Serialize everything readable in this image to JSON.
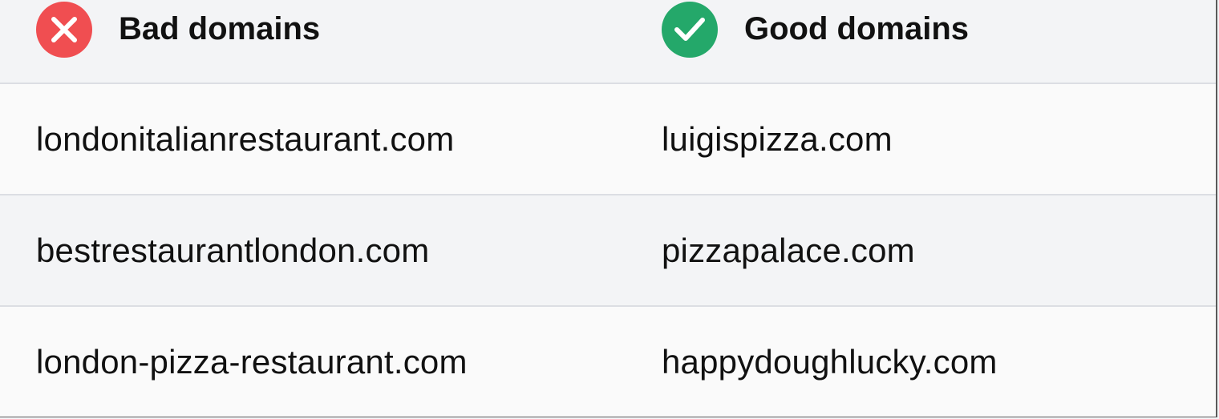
{
  "header": {
    "bad": {
      "label": "Bad domains",
      "icon": "x-icon",
      "color": "#f04e51"
    },
    "good": {
      "label": "Good domains",
      "icon": "check-icon",
      "color": "#24a86a"
    }
  },
  "rows": [
    {
      "bad": "londonitalianrestaurant.com",
      "good": "luigispizza.com"
    },
    {
      "bad": "bestrestaurantlondon.com",
      "good": "pizzapalace.com"
    },
    {
      "bad": "london-pizza-restaurant.com",
      "good": "happydoughlucky.com"
    }
  ]
}
